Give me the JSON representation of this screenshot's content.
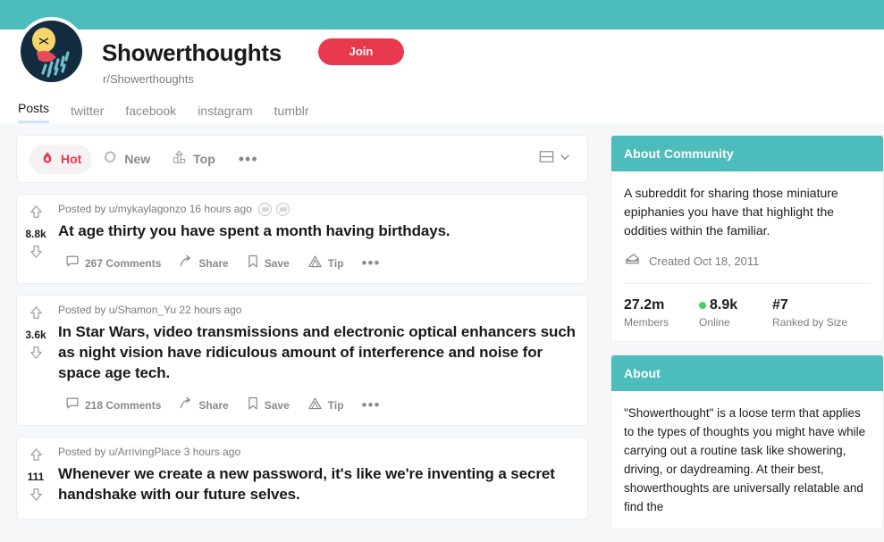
{
  "banner": {
    "color": "#4cbcbc",
    "accent_red": "#e8394f"
  },
  "header": {
    "community_name": "Showerthoughts",
    "community_handle": "r/Showerthoughts",
    "join_label": "Join",
    "avatar_icon": "lightbulb-shower-icon"
  },
  "tabs": [
    {
      "label": "Posts",
      "active": true
    },
    {
      "label": "twitter",
      "active": false
    },
    {
      "label": "facebook",
      "active": false
    },
    {
      "label": "instagram",
      "active": false
    },
    {
      "label": "tumblr",
      "active": false
    }
  ],
  "toolbar": {
    "sorts": [
      {
        "label": "Hot",
        "icon": "flame-icon",
        "active": true
      },
      {
        "label": "New",
        "icon": "sparkle-icon",
        "active": false
      },
      {
        "label": "Top",
        "icon": "podium-icon",
        "active": false
      }
    ],
    "more_label": "•••",
    "view_icon": "card-view-icon",
    "view_chevron_icon": "chevron-down-icon"
  },
  "posts": [
    {
      "score": "8.8k",
      "posted_by": "Posted by u/mykaylagonzo 16 hours ago",
      "title": "At age thirty you have spent a month having birthdays.",
      "awards": 2,
      "actions": {
        "comments": "267 Comments",
        "share": "Share",
        "save": "Save",
        "tip": "Tip",
        "more": "•••"
      }
    },
    {
      "score": "3.6k",
      "posted_by": "Posted by u/Shamon_Yu 22 hours ago",
      "title": "In Star Wars, video transmissions and electronic optical enhancers such as night vision have ridiculous amount of interference and noise for space age tech.",
      "awards": 0,
      "actions": {
        "comments": "218 Comments",
        "share": "Share",
        "save": "Save",
        "tip": "Tip",
        "more": "•••"
      }
    },
    {
      "score": "111",
      "posted_by": "Posted by u/ArrivingPlace 3 hours ago",
      "title": "Whenever we create a new password, it's like we're inventing a secret handshake with our future selves.",
      "awards": 0,
      "actions": {
        "comments": "",
        "share": "",
        "save": "",
        "tip": "",
        "more": ""
      }
    }
  ],
  "sidebar": {
    "about_community": {
      "heading": "About Community",
      "description": "A subreddit for sharing those miniature epiphanies you have that highlight the oddities within the familiar.",
      "created": "Created Oct 18, 2011",
      "created_icon": "cake-icon",
      "stats": [
        {
          "value": "27.2m",
          "label": "Members",
          "online": false
        },
        {
          "value": "8.9k",
          "label": "Online",
          "online": true
        },
        {
          "value": "#7",
          "label": "Ranked by Size",
          "online": false
        }
      ]
    },
    "about": {
      "heading": "About",
      "text": "\"Showerthought\" is a loose term that applies to the types of thoughts you might have while carrying out a routine task like showering, driving, or daydreaming. At their best, showerthoughts are universally relatable and find the"
    }
  }
}
